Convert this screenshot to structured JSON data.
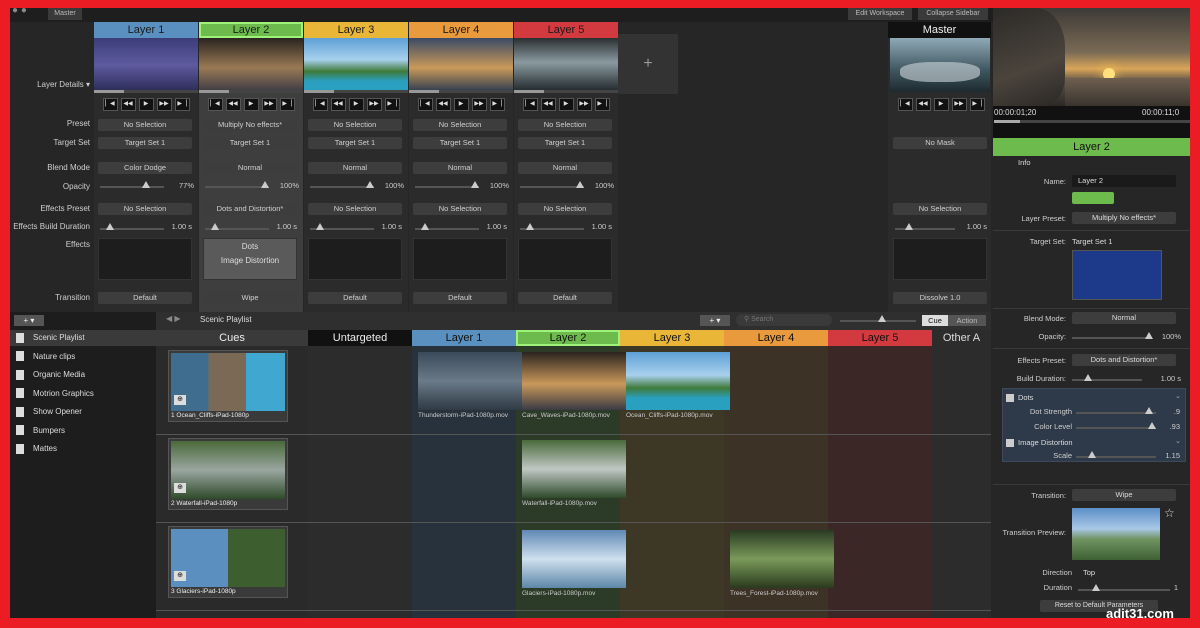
{
  "app": {
    "master_tab": "Master",
    "edit_workspace": "Edit Workspace",
    "collapse_sidebar": "Collapse Sidebar",
    "plus": "+"
  },
  "labels": {
    "layer_details": "Layer Details",
    "preset": "Preset",
    "target_set": "Target Set",
    "blend_mode": "Blend Mode",
    "opacity": "Opacity",
    "effects_preset": "Effects Preset",
    "effects_build_duration": "Effects Build Duration",
    "effects": "Effects",
    "transition": "Transition"
  },
  "layers": [
    {
      "name": "Layer 1",
      "color": "#5a90bf",
      "preset": "No Selection",
      "target": "Target Set 1",
      "blend": "Color Dodge",
      "opacity": "77%",
      "opacity_value": 0.77,
      "effects_preset": "No Selection",
      "duration": "1.00 s",
      "effects": [
        "",
        ""
      ],
      "transition": "Default"
    },
    {
      "name": "Layer 2",
      "color": "#6dbb4c",
      "preset": "Multiply No effects*",
      "target": "Target Set 1",
      "blend": "Normal",
      "opacity": "100%",
      "opacity_value": 1.0,
      "effects_preset": "Dots and Distortion*",
      "duration": "1.00 s",
      "effects": [
        "Dots",
        "Image Distortion"
      ],
      "transition": "Wipe"
    },
    {
      "name": "Layer 3",
      "color": "#e9b638",
      "preset": "No Selection",
      "target": "Target Set 1",
      "blend": "Normal",
      "opacity": "100%",
      "opacity_value": 1.0,
      "effects_preset": "No Selection",
      "duration": "1.00 s",
      "effects": [
        "",
        ""
      ],
      "transition": "Default"
    },
    {
      "name": "Layer 4",
      "color": "#e89a3c",
      "preset": "No Selection",
      "target": "Target Set 1",
      "blend": "Normal",
      "opacity": "100%",
      "opacity_value": 1.0,
      "effects_preset": "No Selection",
      "duration": "1.00 s",
      "effects": [
        "",
        ""
      ],
      "transition": "Default"
    },
    {
      "name": "Layer 5",
      "color": "#d33a3f",
      "preset": "No Selection",
      "target": "Target Set 1",
      "blend": "Normal",
      "opacity": "100%",
      "opacity_value": 1.0,
      "effects_preset": "No Selection",
      "duration": "1.00 s",
      "effects": [
        "",
        ""
      ],
      "transition": "Default"
    }
  ],
  "master": {
    "name": "Master",
    "mask": "No Mask",
    "effects_preset": "No Selection",
    "duration": "1.00 s",
    "transition": "Dissolve 1.0"
  },
  "sidebar": {
    "items": [
      "Scenic Playlist",
      "Nature clips",
      "Organic Media",
      "Motrion Graphics",
      "Show Opener",
      "Bumpers",
      "Mattes"
    ]
  },
  "grid": {
    "title": "Scenic Playlist",
    "search_placeholder": "Search",
    "mode_cue": "Cue",
    "mode_action": "Action",
    "columns": [
      "Cues",
      "Untargeted",
      "Layer 1",
      "Layer 2",
      "Layer 3",
      "Layer 4",
      "Layer 5",
      "Other A"
    ],
    "cues": [
      {
        "label": "1  Ocean_Cliffs-iPad-1080p"
      },
      {
        "label": "2  Waterfall-iPad-1080p"
      },
      {
        "label": "3  Glaciers-iPad-1080p"
      }
    ],
    "clips": {
      "r1l1": "Thunderstorm-iPad-1080p.mov",
      "r1l2": "Cave_Waves-iPad-1080p.mov",
      "r1l3": "Ocean_Cliffs-iPad-1080p.mov",
      "r2l2": "Waterfall-iPad-1080p.mov",
      "r3l2": "Glaciers-iPad-1080p.mov",
      "r3l4": "Trees_Forest-iPad-1080p.mov"
    }
  },
  "preview": {
    "time_left": "00:00:01;20",
    "time_right": "00:00:11;0"
  },
  "inspector": {
    "title": "Layer 2",
    "section": "Info",
    "name_label": "Name:",
    "name_value": "Layer 2",
    "layer_preset_label": "Layer Preset:",
    "layer_preset_value": "Multiply No effects*",
    "target_set_label": "Target Set:",
    "target_set_value": "Target Set 1",
    "blend_label": "Blend Mode:",
    "blend_value": "Normal",
    "opacity_label": "Opacity:",
    "opacity_value": "100%",
    "effects_preset_label": "Effects Preset:",
    "effects_preset_value": "Dots and Distortion*",
    "build_duration_label": "Build Duration:",
    "build_duration_value": "1.00 s",
    "dots_label": "Dots",
    "dot_strength_label": "Dot Strength",
    "dot_strength_value": ".9",
    "color_level_label": "Color Level",
    "color_level_value": ".93",
    "image_distortion_label": "Image Distortion",
    "scale_label": "Scale",
    "scale_value": "1.15",
    "transition_label": "Transition:",
    "transition_value": "Wipe",
    "transition_preview_label": "Transition Preview:",
    "direction_label": "Direction",
    "direction_value": "Top",
    "duration_label": "Duration",
    "duration_value": "1",
    "reset_button": "Reset to Default Parameters"
  },
  "watermark": "adit31.com",
  "colors": {
    "layer1": "#5a90bf",
    "layer2": "#6dbb4c",
    "layer3": "#e9b638",
    "layer4": "#e89a3c",
    "layer5": "#d33a3f",
    "frame": "#ec1c24"
  }
}
